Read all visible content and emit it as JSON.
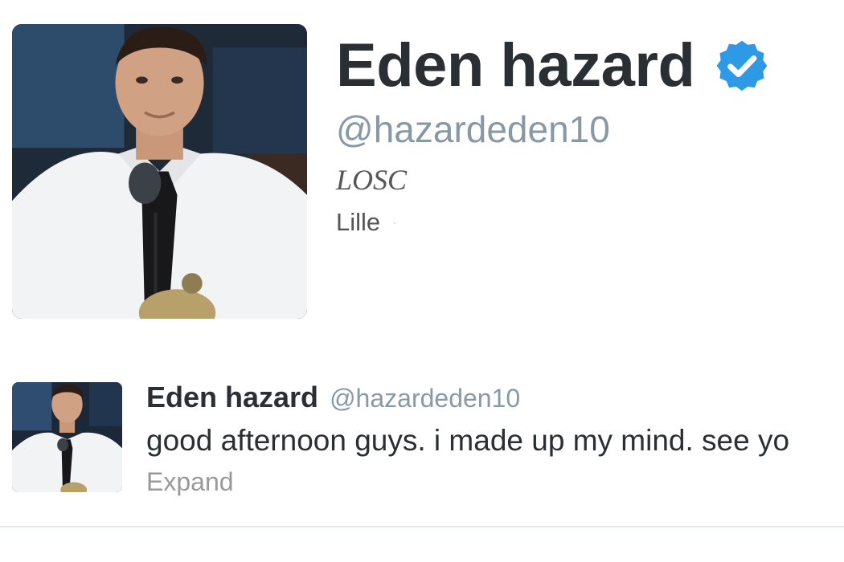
{
  "profile": {
    "name": "Eden hazard",
    "handle": "@hazardeden10",
    "bio": "LOSC",
    "location": "Lille",
    "location_separator": "·",
    "verified": true,
    "avatar_icon": "profile-photo"
  },
  "tweet": {
    "author_name": "Eden hazard",
    "author_handle": "@hazardeden10",
    "text": "good afternoon guys. i made up my mind. see yo",
    "expand_label": "Expand",
    "avatar_icon": "profile-photo"
  },
  "colors": {
    "verified_badge": "#2e9ae6",
    "handle_gray": "#8899a6",
    "text_dark": "#292f33"
  }
}
